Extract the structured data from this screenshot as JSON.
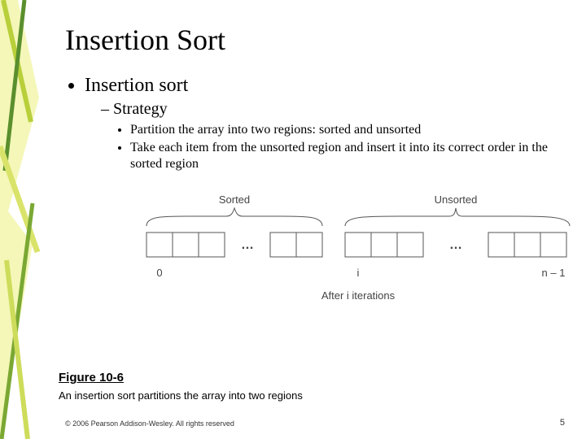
{
  "title": "Insertion Sort",
  "bullets": {
    "top": "Insertion sort",
    "strategy": "Strategy",
    "point1": "Partition the array into two regions: sorted and unsorted",
    "point2": "Take each item from the unsorted region and insert it into its correct order in the sorted region"
  },
  "diagram": {
    "sorted_label": "Sorted",
    "unsorted_label": "Unsorted",
    "idx0": "0",
    "idxi": "i",
    "idxn": "n – 1",
    "after": "After i iterations",
    "dots": "…"
  },
  "figure": {
    "label": "Figure 10-6",
    "caption": "An insertion sort partitions the array into two regions"
  },
  "footer": {
    "copyright": "© 2006 Pearson Addison-Wesley. All rights reserved",
    "slide": "5"
  }
}
